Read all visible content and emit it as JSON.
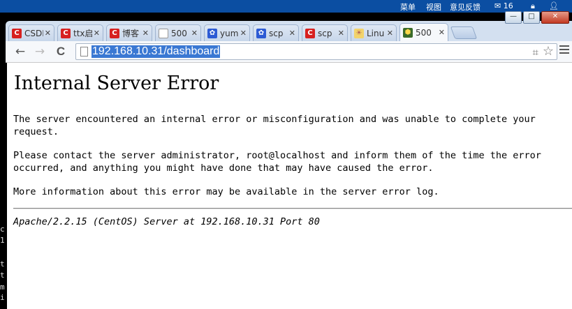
{
  "os": {
    "menu": [
      "菜单",
      "视图",
      "意见反馈"
    ],
    "mail_count": "16",
    "controls": [
      "—",
      "□",
      "✕"
    ]
  },
  "tabs": [
    {
      "icon": "csdn-icon",
      "title": "CSDN"
    },
    {
      "icon": "csdn-icon",
      "title": "ttx启"
    },
    {
      "icon": "csdn-icon",
      "title": "博客"
    },
    {
      "icon": "document-icon",
      "title": "500"
    },
    {
      "icon": "baidu-paw-icon",
      "title": "yum"
    },
    {
      "icon": "baidu-paw-icon",
      "title": "scp"
    },
    {
      "icon": "csdn-icon",
      "title": "scp"
    },
    {
      "icon": "linux-icon",
      "title": "Linu"
    },
    {
      "icon": "server-icon",
      "title": "500",
      "active": true
    }
  ],
  "toolbar": {
    "back": "←",
    "forward": "→",
    "reload": "C",
    "url": "192.168.10.31/dashboard",
    "translate_icon": "⌗",
    "star_icon": "☆"
  },
  "page": {
    "title": "Internal Server Error",
    "p1": "The server encountered an internal error or misconfiguration and was unable to complete your request.",
    "p2": "Please contact the server administrator, root@localhost and inform them of the time the error occurred, and anything you might have done that may have caused the error.",
    "p3": "More information about this error may be available in the server error log.",
    "address": "Apache/2.2.15 (CentOS) Server at 192.168.10.31 Port 80"
  },
  "colors": {
    "selection": "#3a78d3",
    "frame": "#d3e0f0"
  }
}
